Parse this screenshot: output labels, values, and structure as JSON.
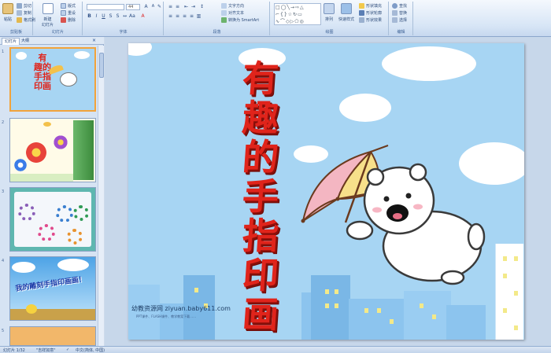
{
  "ribbon": {
    "clipboard": {
      "paste": "粘贴",
      "cut": "剪切",
      "copy": "复制",
      "format_painter": "格式刷",
      "label": "剪贴板"
    },
    "slides": {
      "new_slide": "新建\n幻灯片",
      "layout": "版式",
      "reset": "重设",
      "delete": "删除",
      "label": "幻灯片"
    },
    "font": {
      "font_size": "44",
      "label": "字体"
    },
    "paragraph": {
      "text_direction": "文字方向",
      "align_text": "对齐文本",
      "smartart": "转换为 SmartArt",
      "label": "段落"
    },
    "drawing": {
      "arrange": "排列",
      "quick_styles": "快速样式",
      "shape_fill": "形状填充",
      "shape_outline": "形状轮廓",
      "shape_effects": "形状效果",
      "label": "绘图"
    },
    "editing": {
      "find": "查找",
      "replace": "替换",
      "select": "选择",
      "label": "编辑"
    }
  },
  "panel": {
    "tabs": [
      "幻灯片",
      "大纲"
    ],
    "thumb_numbers": [
      "1",
      "2",
      "3",
      "4",
      "5"
    ],
    "thumb4_text": "我的雕刻手指印画画！"
  },
  "slide": {
    "title_chars": [
      "有",
      "趣",
      "的",
      "手",
      "指",
      "印",
      "画"
    ],
    "watermark": "幼教资源网 ziyuan.baby611.com",
    "watermark_sub": "PPT课件、FLASH课件、教学教案下载……"
  },
  "status": {
    "slide_info": "幻灯片 1/32",
    "theme": "\"吉祥如意\"",
    "language": "中文(简体, 中国)"
  },
  "colors": {
    "title_red": "#e0241b",
    "sky": "#a7d5f3",
    "selected_border": "#f2a33a"
  }
}
